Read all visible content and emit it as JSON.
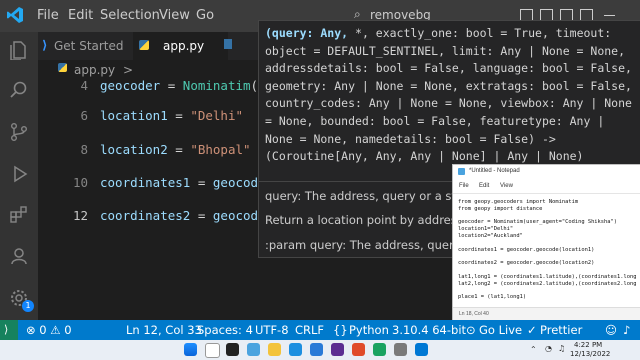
{
  "menu": [
    "File",
    "Edit",
    "Selection",
    "View",
    "Go"
  ],
  "command_center": {
    "label": "removebg"
  },
  "tabs": [
    {
      "label": "Get Started",
      "active": false
    },
    {
      "label": "app.py",
      "active": true
    }
  ],
  "breadcrumb": {
    "file": "app.py",
    "sep": ">"
  },
  "editor": {
    "lines": [
      {
        "num": "4",
        "tokens": [
          [
            "var",
            "geocoder"
          ],
          [
            "op",
            " = "
          ],
          [
            "cls",
            "Nominatim"
          ],
          [
            "op",
            "(use"
          ]
        ]
      },
      {
        "num": "6",
        "tokens": [
          [
            "var",
            "location1"
          ],
          [
            "op",
            " = "
          ],
          [
            "str",
            "\"Delhi\""
          ]
        ]
      },
      {
        "num": "8",
        "tokens": [
          [
            "var",
            "location2"
          ],
          [
            "op",
            " = "
          ],
          [
            "str",
            "\"Bhopal\""
          ]
        ]
      },
      {
        "num": "10",
        "tokens": [
          [
            "var",
            "coordinates1"
          ],
          [
            "op",
            " = "
          ],
          [
            "var",
            "geocoder"
          ],
          [
            "op",
            "."
          ]
        ]
      },
      {
        "num": "12",
        "tokens": [
          [
            "var",
            "coordinates2"
          ],
          [
            "op",
            " = "
          ],
          [
            "var",
            "geocoder"
          ],
          [
            "op",
            "."
          ]
        ]
      }
    ]
  },
  "hover": {
    "signature_parts": [
      [
        "(query: Any, ",
        "#9cdcfe"
      ],
      [
        "*, exactly_one: bool = True, timeout: object = DEFAULT_SENTINEL, limit: Any | None = None, addressdetails: bool = False, language: bool = False, geometry: Any | None = None, extratags: bool = False, country_codes: Any | None = None, viewbox: Any | None = None, bounded: bool = False, featuretype: Any | None = None, namedetails: bool = False) -> (Coroutine[Any, Any, Any | None] | Any | None)",
        "#d4d4d4"
      ]
    ],
    "doc_lines": [
      "query: The address, query or a structured query",
      "Return a location point by address.",
      ":param query: The address, query or a"
    ]
  },
  "notepad": {
    "title": "*Untitled - Notepad",
    "menu": [
      "File",
      "Edit",
      "View"
    ],
    "content": "from geopy.geocoders import Nominatim\nfrom geopy import distance\n\ngeocoder = Nominatim(user_agent=\"Coding Shiksha\")\nlocation1=\"Delhi\"\nlocation2=\"Auckland\"\n\ncoordinates1 = geocoder.geocode(location1)\n\ncoordinates2 = geocoder.geocode(location2)\n\nlat1,long1 = (coordinates1.latitude),(coordinates1.long\nlat2,long2 = (coordinates2.latitude),(coordinates2.long\n\nplace1 = (lat1,long1)",
    "status": "Ln 18, Col 40"
  },
  "statusbar": {
    "problems": "⊗ 0 ⚠ 0",
    "position": "Ln 12, Col 33",
    "spaces": "Spaces: 4",
    "encoding": "UTF-8",
    "eol": "CRLF",
    "language": "Python",
    "interpreter": "3.10.4 64-bit",
    "golive": "Go Live",
    "prettier": "Prettier"
  },
  "taskbar": {
    "time": "4:22 PM",
    "date": "12/13/2022"
  },
  "colors": {
    "statusbar": "#007acc",
    "accent": "#0e639c",
    "badge": "#1185fe"
  }
}
